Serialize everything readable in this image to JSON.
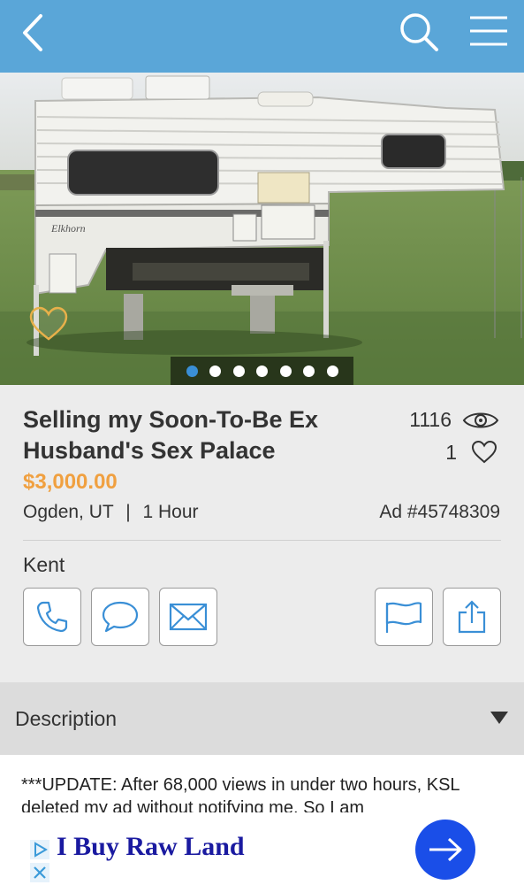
{
  "header": {
    "back_icon": "chevron-left-icon",
    "search_icon": "search-icon",
    "menu_icon": "hamburger-menu-icon"
  },
  "gallery": {
    "image_count": 7,
    "active_index": 0,
    "favorite_icon": "heart-outline-icon"
  },
  "listing": {
    "title": "Selling my Soon-To-Be Ex Husband's Sex Palace",
    "price": "$3,000.00",
    "location": "Ogden, UT",
    "separator": "|",
    "posted": "1 Hour",
    "views": "1116",
    "favorites": "1",
    "ad_number": "Ad #45748309",
    "seller": "Kent"
  },
  "actions": {
    "call_icon": "phone-icon",
    "chat_icon": "chat-bubble-icon",
    "email_icon": "envelope-icon",
    "report_icon": "flag-icon",
    "share_icon": "share-icon"
  },
  "description": {
    "label": "Description",
    "text": "***UPDATE: After 68,000 views in under two hours, KSL deleted my ad without notifying me. So I am"
  },
  "advert": {
    "text": "I Buy Raw Land",
    "colors": {
      "text": "#1a1aa0",
      "button": "#1a4ee8"
    }
  },
  "colors": {
    "header": "#5aa6d8",
    "price": "#f0a040",
    "active_dot": "#3a8fd6"
  }
}
